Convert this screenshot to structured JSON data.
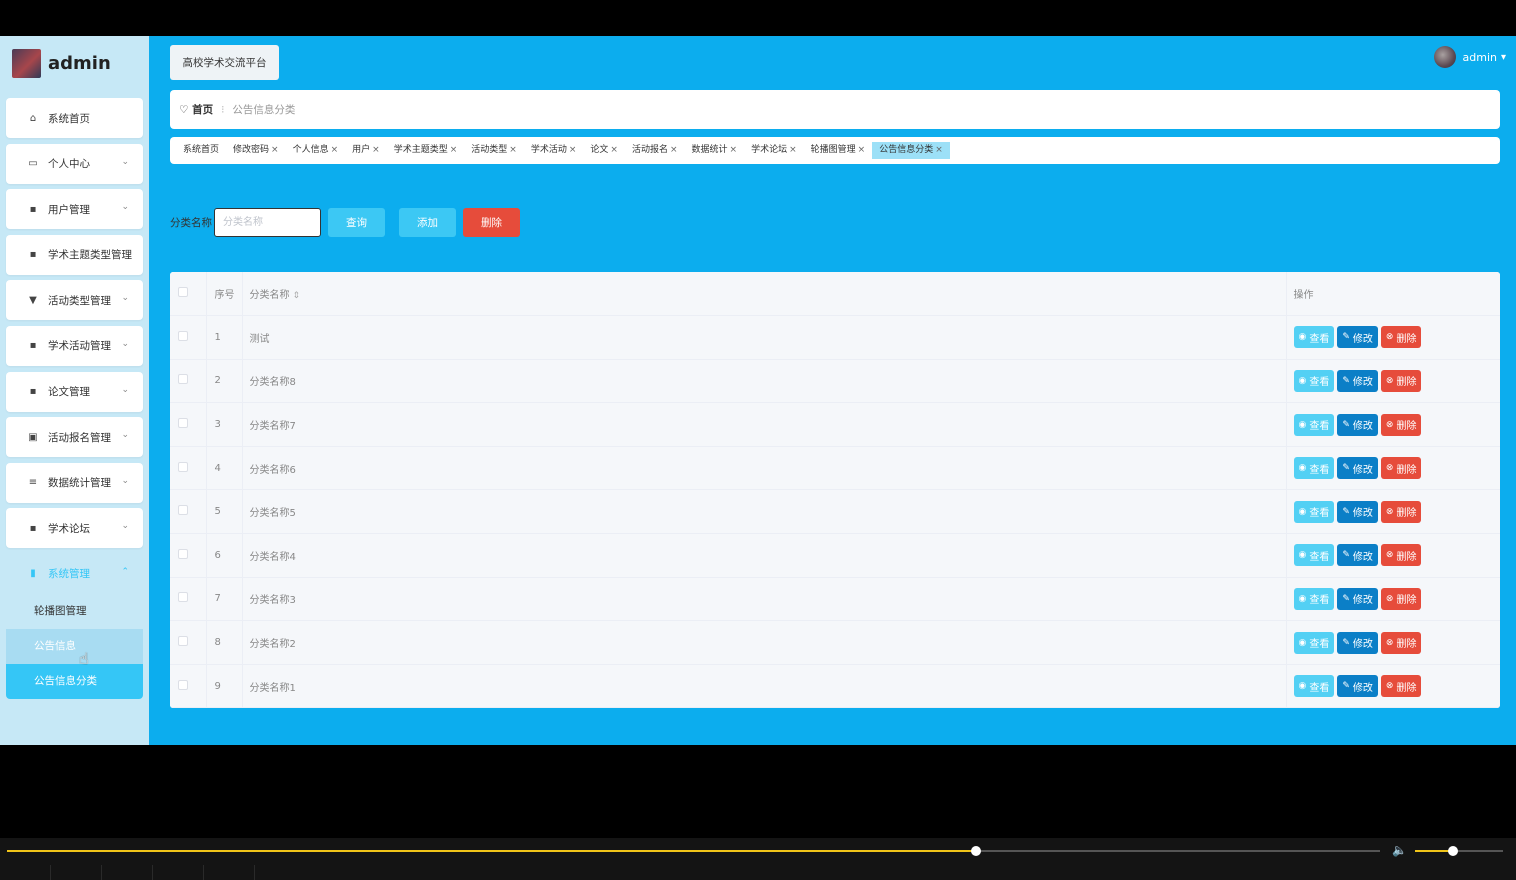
{
  "colors": {
    "sidebar_bg": "#c6e8f6",
    "main_bg": "#0cadee",
    "accent": "#35c6f6",
    "danger": "#e64c3b",
    "edit": "#0b7fc7"
  },
  "brand": {
    "name": "admin"
  },
  "sidebar": {
    "items": [
      {
        "label": "系统首页",
        "icon": "home-icon",
        "glyph": "⌂"
      },
      {
        "label": "个人中心",
        "icon": "card-icon",
        "glyph": "▭",
        "chevron": "⌄"
      },
      {
        "label": "用户管理",
        "icon": "grid-icon",
        "glyph": "▪",
        "chevron": "⌄"
      },
      {
        "label": "学术主题类型管理",
        "icon": "grid-icon",
        "glyph": "▪"
      },
      {
        "label": "活动类型管理",
        "icon": "pin-icon",
        "glyph": "▼",
        "chevron": "⌄"
      },
      {
        "label": "学术活动管理",
        "icon": "grid-icon",
        "glyph": "▪",
        "chevron": "⌄"
      },
      {
        "label": "论文管理",
        "icon": "grid-icon",
        "glyph": "▪",
        "chevron": "⌄"
      },
      {
        "label": "活动报名管理",
        "icon": "clipboard-icon",
        "glyph": "▣",
        "chevron": "⌄"
      },
      {
        "label": "数据统计管理",
        "icon": "list-icon",
        "glyph": "≡",
        "chevron": "⌄"
      },
      {
        "label": "学术论坛",
        "icon": "grid-icon",
        "glyph": "▪",
        "chevron": "⌄"
      }
    ],
    "system": {
      "label": "系统管理",
      "icon": "bar-chart-icon",
      "glyph": "▮",
      "chevron": "⌃"
    },
    "sub_items": [
      "轮播图管理",
      "公告信息",
      "公告信息分类"
    ]
  },
  "header": {
    "platform": "高校学术交流平台",
    "user": "admin",
    "caret": "▾"
  },
  "breadcrumb": {
    "home": "♡ 首页",
    "sep": "⁝",
    "current": "公告信息分类"
  },
  "tags": [
    "系统首页",
    "修改密码",
    "个人信息",
    "用户",
    "学术主题类型",
    "活动类型",
    "学术活动",
    "论文",
    "活动报名",
    "数据统计",
    "学术论坛",
    "轮播图管理",
    "公告信息分类"
  ],
  "tag_close": "×",
  "search": {
    "label": "分类名称",
    "placeholder": "分类名称",
    "query": "查询",
    "add": "添加",
    "delete": "删除"
  },
  "table": {
    "headers": {
      "index": "序号",
      "name": "分类名称",
      "sort": "⇕",
      "ops": "操作"
    },
    "rows": [
      {
        "index": "1",
        "name": "测试"
      },
      {
        "index": "2",
        "name": "分类名称8"
      },
      {
        "index": "3",
        "name": "分类名称7"
      },
      {
        "index": "4",
        "name": "分类名称6"
      },
      {
        "index": "5",
        "name": "分类名称5"
      },
      {
        "index": "6",
        "name": "分类名称4"
      },
      {
        "index": "7",
        "name": "分类名称3"
      },
      {
        "index": "8",
        "name": "分类名称2"
      },
      {
        "index": "9",
        "name": "分类名称1"
      }
    ],
    "actions": {
      "view": "查看",
      "edit": "修改",
      "delete": "删除",
      "view_icon": "◉",
      "edit_icon": "✎",
      "delete_icon": "⊗"
    }
  },
  "player": {
    "progress": 0.706,
    "volume": 0.43
  }
}
